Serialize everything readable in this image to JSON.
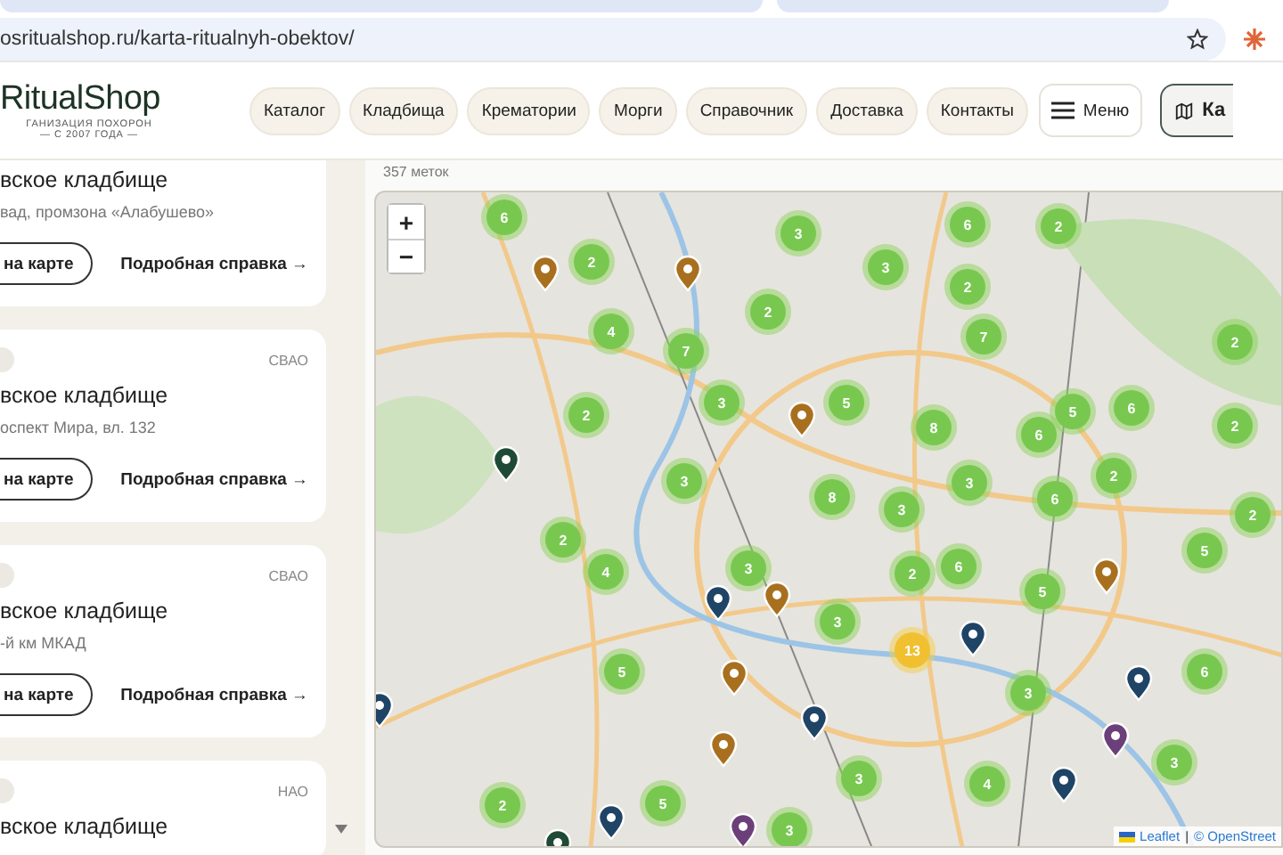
{
  "browser": {
    "url": "osritualshop.ru/karta-ritualnyh-obektov/"
  },
  "header": {
    "logo": {
      "name": "RitualShop",
      "tagline": "ГАНИЗАЦИЯ ПОХОРОН",
      "since": "— С 2007 ГОДА —"
    },
    "nav": [
      "Каталог",
      "Кладбища",
      "Крематории",
      "Морги",
      "Справочник",
      "Доставка",
      "Контакты"
    ],
    "menu_button": "Меню",
    "map_button": "Ка"
  },
  "cards": [
    {
      "title": "вское кладбище",
      "address": "вад, промзона «Алабушево»",
      "show_button": "на карте",
      "details_link": "Подробная справка →"
    },
    {
      "region": "СВАО",
      "title": "вское кладбище",
      "address": "оспект Мира, вл. 132",
      "show_button": "на карте",
      "details_link": "Подробная справка →"
    },
    {
      "region": "СВАО",
      "title": "вское кладбище",
      "address": "-й км МКАД",
      "show_button": "на карте",
      "details_link": "Подробная справка →"
    },
    {
      "region": "НАО",
      "title": "вское кладбище"
    }
  ],
  "map": {
    "count_label": "357 меток",
    "zoom_in": "+",
    "zoom_out": "−",
    "clusters": [
      {
        "label": "6",
        "kind": "small"
      },
      {
        "label": "2",
        "kind": "small"
      },
      {
        "label": "3",
        "kind": "small"
      },
      {
        "label": "6",
        "kind": "small"
      },
      {
        "label": "2",
        "kind": "small"
      },
      {
        "label": "3",
        "kind": "small"
      },
      {
        "label": "2",
        "kind": "small"
      },
      {
        "label": "2",
        "kind": "small"
      },
      {
        "label": "4",
        "kind": "small"
      },
      {
        "label": "7",
        "kind": "small"
      },
      {
        "label": "7",
        "kind": "small"
      },
      {
        "label": "2",
        "kind": "small"
      },
      {
        "label": "2",
        "kind": "small"
      },
      {
        "label": "3",
        "kind": "small"
      },
      {
        "label": "5",
        "kind": "small"
      },
      {
        "label": "2",
        "kind": "small"
      },
      {
        "label": "8",
        "kind": "small"
      },
      {
        "label": "6",
        "kind": "small"
      },
      {
        "label": "5",
        "kind": "small"
      },
      {
        "label": "6",
        "kind": "small"
      },
      {
        "label": "2",
        "kind": "small"
      },
      {
        "label": "3",
        "kind": "small"
      },
      {
        "label": "8",
        "kind": "small"
      },
      {
        "label": "3",
        "kind": "small"
      },
      {
        "label": "3",
        "kind": "small"
      },
      {
        "label": "6",
        "kind": "small"
      },
      {
        "label": "2",
        "kind": "small"
      },
      {
        "label": "2",
        "kind": "small"
      },
      {
        "label": "4",
        "kind": "small"
      },
      {
        "label": "3",
        "kind": "small"
      },
      {
        "label": "2",
        "kind": "small"
      },
      {
        "label": "6",
        "kind": "small"
      },
      {
        "label": "5",
        "kind": "small"
      },
      {
        "label": "5",
        "kind": "small"
      },
      {
        "label": "3",
        "kind": "small"
      },
      {
        "label": "13",
        "kind": "large"
      },
      {
        "label": "5",
        "kind": "small"
      },
      {
        "label": "3",
        "kind": "small"
      },
      {
        "label": "6",
        "kind": "small"
      },
      {
        "label": "3",
        "kind": "small"
      },
      {
        "label": "3",
        "kind": "small"
      },
      {
        "label": "4",
        "kind": "small"
      },
      {
        "label": "2",
        "kind": "small"
      },
      {
        "label": "5",
        "kind": "small"
      },
      {
        "label": "3",
        "kind": "small"
      }
    ],
    "pins": [
      {
        "color": "#a8701e"
      },
      {
        "color": "#a8701e"
      },
      {
        "color": "#a8701e"
      },
      {
        "color": "#a8701e"
      },
      {
        "color": "#a8701e"
      },
      {
        "color": "#a8701e"
      },
      {
        "color": "#a8701e"
      },
      {
        "color": "#1f4a36"
      },
      {
        "color": "#1f4a36"
      },
      {
        "color": "#1f4466"
      },
      {
        "color": "#1f4466"
      },
      {
        "color": "#1f4466"
      },
      {
        "color": "#1f4466"
      },
      {
        "color": "#1f4466"
      },
      {
        "color": "#1f4466"
      },
      {
        "color": "#1f4466"
      },
      {
        "color": "#6b3f7a"
      },
      {
        "color": "#6b3f7a"
      }
    ],
    "attribution": {
      "leaflet": "Leaflet",
      "separator": "|",
      "osm": "© OpenStreet"
    }
  }
}
